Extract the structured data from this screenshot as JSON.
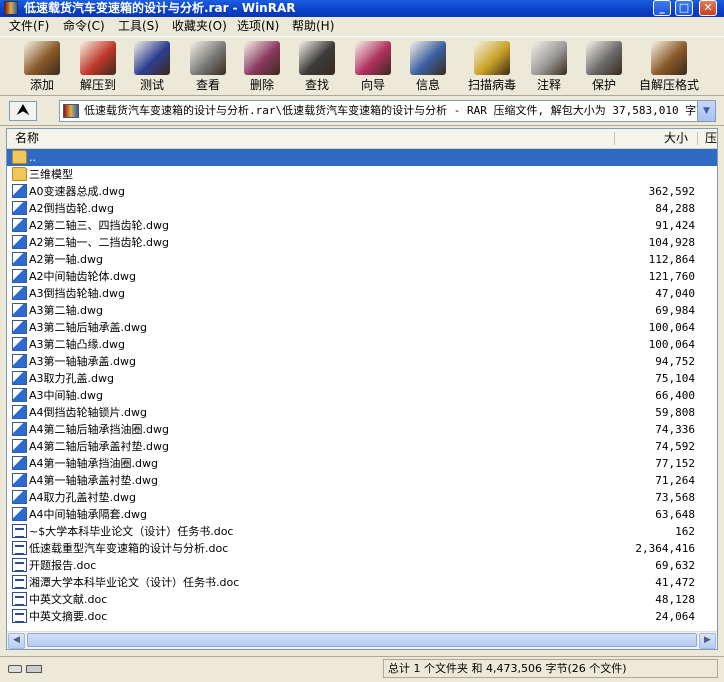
{
  "window": {
    "title": "低速载货汽车变速箱的设计与分析.rar - WinRAR"
  },
  "menu": [
    "文件(F)",
    "命令(C)",
    "工具(S)",
    "收藏夹(O)",
    "选项(N)",
    "帮助(H)"
  ],
  "toolbar": [
    {
      "label": "添加",
      "icon": "add-archive-icon",
      "color": "#8a5a2a"
    },
    {
      "label": "解压到",
      "icon": "extract-to-icon",
      "color": "#c0392b"
    },
    {
      "label": "测试",
      "icon": "test-icon",
      "color": "#2c3e8f"
    },
    {
      "label": "查看",
      "icon": "view-glasses-icon",
      "color": "#7a7a7a"
    },
    {
      "label": "删除",
      "icon": "delete-icon",
      "color": "#8b3a62"
    },
    {
      "label": "查找",
      "icon": "find-binoculars-icon",
      "color": "#3b3b3b"
    },
    {
      "label": "向导",
      "icon": "wizard-icon",
      "color": "#b03060"
    },
    {
      "label": "信息",
      "icon": "info-icon",
      "color": "#3a5fa0"
    },
    {
      "label": "扫描病毒",
      "icon": "virus-scan-icon",
      "color": "#c9a227"
    },
    {
      "label": "注释",
      "icon": "comment-icon",
      "color": "#9a9a9a"
    },
    {
      "label": "保护",
      "icon": "protect-shield-icon",
      "color": "#6b6b6b"
    },
    {
      "label": "自解压格式",
      "icon": "sfx-icon",
      "color": "#8a5a2a"
    }
  ],
  "address": {
    "text": "低速载货汽车变速箱的设计与分析.rar\\低速载货汽车变速箱的设计与分析 - RAR 压缩文件, 解包大小为 37,583,010 字节"
  },
  "columns": {
    "name": "名称",
    "size": "大小",
    "packed": "压"
  },
  "files": [
    {
      "name": "..",
      "size": "",
      "type": "folder"
    },
    {
      "name": "三维模型",
      "size": "",
      "type": "folder"
    },
    {
      "name": "A0变速器总成.dwg",
      "size": "362,592",
      "type": "dwg"
    },
    {
      "name": "A2倒挡齿轮.dwg",
      "size": "84,288",
      "type": "dwg"
    },
    {
      "name": "A2第二轴三、四挡齿轮.dwg",
      "size": "91,424",
      "type": "dwg"
    },
    {
      "name": "A2第二轴一、二挡齿轮.dwg",
      "size": "104,928",
      "type": "dwg"
    },
    {
      "name": "A2第一轴.dwg",
      "size": "112,864",
      "type": "dwg"
    },
    {
      "name": "A2中间轴齿轮体.dwg",
      "size": "121,760",
      "type": "dwg"
    },
    {
      "name": "A3倒挡齿轮轴.dwg",
      "size": "47,040",
      "type": "dwg"
    },
    {
      "name": "A3第二轴.dwg",
      "size": "69,984",
      "type": "dwg"
    },
    {
      "name": "A3第二轴后轴承盖.dwg",
      "size": "100,064",
      "type": "dwg"
    },
    {
      "name": "A3第二轴凸缘.dwg",
      "size": "100,064",
      "type": "dwg"
    },
    {
      "name": "A3第一轴轴承盖.dwg",
      "size": "94,752",
      "type": "dwg"
    },
    {
      "name": "A3取力孔盖.dwg",
      "size": "75,104",
      "type": "dwg"
    },
    {
      "name": "A3中间轴.dwg",
      "size": "66,400",
      "type": "dwg"
    },
    {
      "name": "A4倒挡齿轮轴锁片.dwg",
      "size": "59,808",
      "type": "dwg"
    },
    {
      "name": "A4第二轴后轴承挡油圈.dwg",
      "size": "74,336",
      "type": "dwg"
    },
    {
      "name": "A4第二轴后轴承盖衬垫.dwg",
      "size": "74,592",
      "type": "dwg"
    },
    {
      "name": "A4第一轴轴承挡油圈.dwg",
      "size": "77,152",
      "type": "dwg"
    },
    {
      "name": "A4第一轴轴承盖衬垫.dwg",
      "size": "71,264",
      "type": "dwg"
    },
    {
      "name": "A4取力孔盖衬垫.dwg",
      "size": "73,568",
      "type": "dwg"
    },
    {
      "name": "A4中间轴轴承隔套.dwg",
      "size": "63,648",
      "type": "dwg"
    },
    {
      "name": "~$大学本科毕业论文（设计）任务书.doc",
      "size": "162",
      "type": "doc"
    },
    {
      "name": "低速载重型汽车变速箱的设计与分析.doc",
      "size": "2,364,416",
      "type": "doc"
    },
    {
      "name": "开题报告.doc",
      "size": "69,632",
      "type": "doc"
    },
    {
      "name": "湘潭大学本科毕业论文（设计）任务书.doc",
      "size": "41,472",
      "type": "doc"
    },
    {
      "name": "中英文文献.doc",
      "size": "48,128",
      "type": "doc"
    },
    {
      "name": "中英文摘要.doc",
      "size": "24,064",
      "type": "doc"
    }
  ],
  "status": {
    "text": "总计 1 个文件夹 和 4,473,506 字节(26 个文件)"
  }
}
